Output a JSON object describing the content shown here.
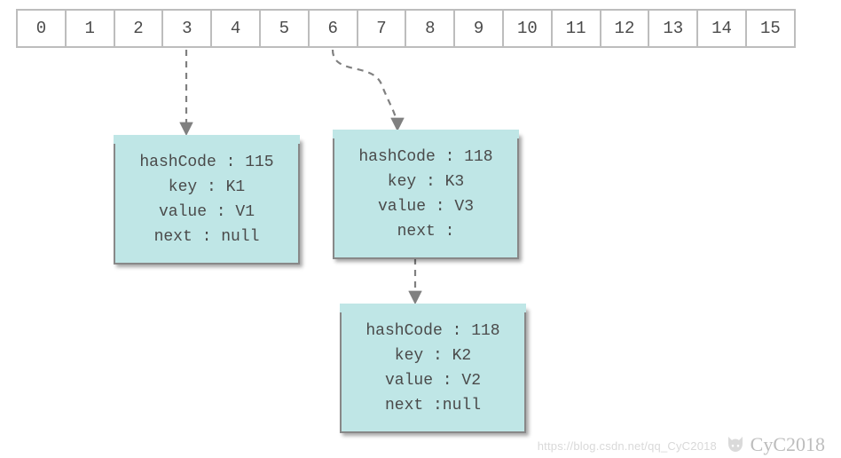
{
  "array": {
    "length": 16,
    "indices": [
      "0",
      "1",
      "2",
      "3",
      "4",
      "5",
      "6",
      "7",
      "8",
      "9",
      "10",
      "11",
      "12",
      "13",
      "14",
      "15"
    ]
  },
  "nodes": {
    "n1": {
      "hashCodeLabel": "hashCode : 115",
      "keyLabel": "key : K1",
      "valueLabel": "value : V1",
      "nextLabel": "next : null"
    },
    "n2": {
      "hashCodeLabel": "hashCode : 118",
      "keyLabel": "key : K3",
      "valueLabel": "value : V3",
      "nextLabel": "next :"
    },
    "n3": {
      "hashCodeLabel": "hashCode : 118",
      "keyLabel": "key : K2",
      "valueLabel": "value : V2",
      "nextLabel": "next :null"
    }
  },
  "watermark": {
    "url": "https://blog.csdn.net/qq_CyC2018",
    "signature": "CyC2018"
  },
  "chart_data": {
    "type": "diagram",
    "description": "HashMap bucket array with separate chaining",
    "array_size": 16,
    "buckets": [
      {
        "index": 3,
        "chain": [
          {
            "hashCode": 115,
            "key": "K1",
            "value": "V1",
            "next": null
          }
        ]
      },
      {
        "index": 6,
        "chain": [
          {
            "hashCode": 118,
            "key": "K3",
            "value": "V3",
            "next": "node-k2"
          },
          {
            "hashCode": 118,
            "key": "K2",
            "value": "V2",
            "next": null
          }
        ]
      }
    ]
  }
}
